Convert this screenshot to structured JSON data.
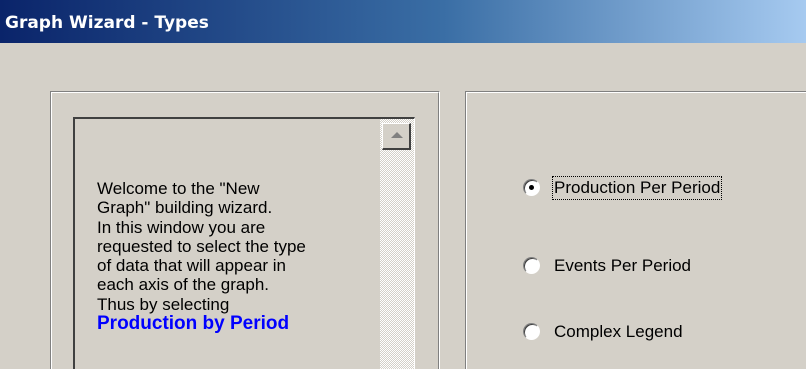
{
  "window": {
    "title": "Graph Wizard - Types"
  },
  "help_text": {
    "lines": [
      "Welcome to the \"New",
      "Graph\" building wizard.",
      "In this window you are",
      "requested to select the type",
      "of data that will appear in",
      "each axis of the graph.",
      "Thus by selecting"
    ],
    "highlight": "Production by Period"
  },
  "graph_types": {
    "selected": "Production Per Period",
    "options": [
      {
        "label": "Production Per Period",
        "checked": true
      },
      {
        "label": "Events Per Period",
        "checked": false
      },
      {
        "label": "Complex Legend",
        "checked": false
      }
    ]
  },
  "colors": {
    "title_gradient_start": "#0a246a",
    "title_gradient_end": "#a6caf0",
    "dialog_background": "#d4d0c8",
    "highlight_text": "#0000ff"
  },
  "icons": {
    "scroll_up": "scroll-up-arrow-icon"
  }
}
